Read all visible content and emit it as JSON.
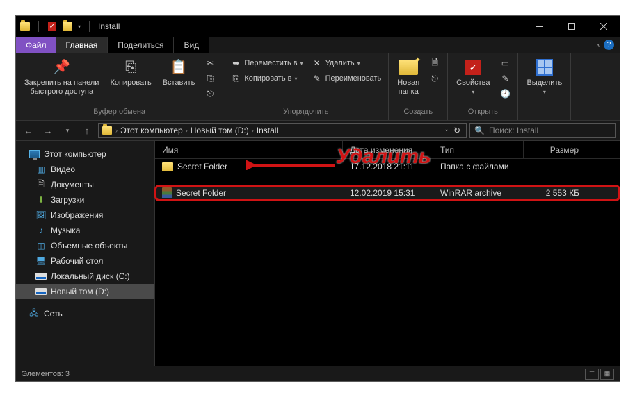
{
  "title": "Install",
  "menu": {
    "file": "Файл",
    "home": "Главная",
    "share": "Поделиться",
    "view": "Вид"
  },
  "ribbon": {
    "pin": "Закрепить на панели\nбыстрого доступа",
    "copy": "Копировать",
    "paste": "Вставить",
    "clipboard_group": "Буфер обмена",
    "move_to": "Переместить в",
    "copy_to": "Копировать в",
    "delete": "Удалить",
    "rename": "Переименовать",
    "organize_group": "Упорядочить",
    "new_folder": "Новая\nпапка",
    "create_group": "Создать",
    "properties": "Свойства",
    "open_group": "Открыть",
    "select": "Выделить",
    "select_all": "⬚",
    "select_none": "⬚",
    "invert": "⬚"
  },
  "path": {
    "this_pc": "Этот компьютер",
    "volume": "Новый том (D:)",
    "folder": "Install"
  },
  "search": {
    "placeholder": "Поиск: Install"
  },
  "sidebar": {
    "this_pc": "Этот компьютер",
    "videos": "Видео",
    "documents": "Документы",
    "downloads": "Загрузки",
    "pictures": "Изображения",
    "music": "Музыка",
    "objects3d": "Объемные объекты",
    "desktop": "Рабочий стол",
    "disk_c": "Локальный диск (C:)",
    "disk_d": "Новый том (D:)",
    "network": "Сеть"
  },
  "columns": {
    "name": "Имя",
    "date": "Дата изменения",
    "type": "Тип",
    "size": "Размер"
  },
  "files": [
    {
      "name": "Secret Folder",
      "date": "17.12.2018 21:11",
      "type": "Папка с файлами",
      "size": ""
    },
    {
      "name": "Secret Folder",
      "date": "12.02.2019 15:31",
      "type": "WinRAR archive",
      "size": "2 553 КБ"
    }
  ],
  "annotation": "Удалить",
  "status": "Элементов: 3"
}
